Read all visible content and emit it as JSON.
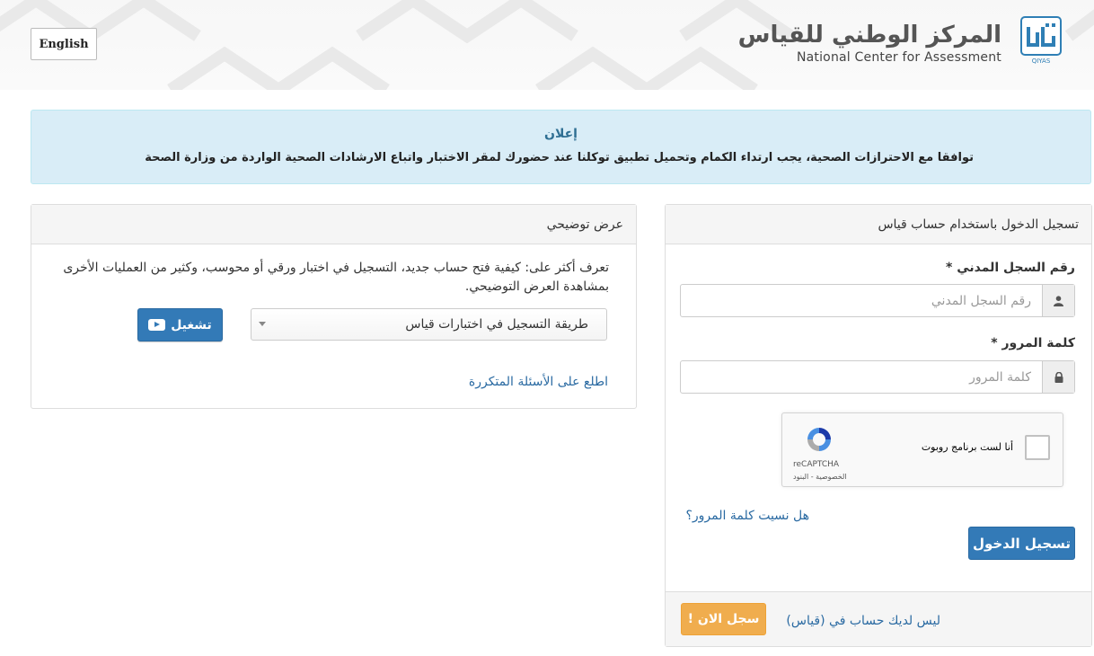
{
  "header": {
    "lang_button": "English",
    "logo_ar": "المركز الوطني للقياس",
    "logo_en": "National Center for Assessment",
    "logo_mark_text": "QIYAS"
  },
  "announcement": {
    "title": "إعلان",
    "message": "توافقا مع الاحترازات الصحية، يجب ارتداء الكمام وتحميل تطبيق توكلنا عند حضورك لمقر الاختبار واتباع الارشادات الصحية الواردة من وزارة الصحة"
  },
  "demo_panel": {
    "title": "عرض توضيحي",
    "description": "تعرف أكثر على: كيفية فتح حساب جديد، التسجيل في اختبار ورقي أو محوسب، وكثير من العمليات الأخرى بمشاهدة العرض التوضيحي.",
    "select_value": "طريقة التسجيل في اختبارات قياس",
    "play_label": "تشغيل",
    "faq_link": "اطلع على الأسئلة المتكررة"
  },
  "login_panel": {
    "title": "تسجيل الدخول باستخدام حساب قياس",
    "id_label": "رقم السجل المدني *",
    "id_placeholder": "رقم السجل المدني",
    "password_label": "كلمة المرور *",
    "password_placeholder": "كلمة المرور",
    "captcha_label": "أنا لست برنامج روبوت",
    "captcha_brand": "reCAPTCHA",
    "captcha_terms": "الخصوصية - البنود",
    "forgot_link": "هل نسيت كلمة المرور؟",
    "submit_label": "تسجيل الدخول",
    "no_account_text": "ليس لديك حساب في (قياس)",
    "register_label": "سجل الان !"
  },
  "colors": {
    "primary": "#337ab7",
    "warning": "#f0ad4e",
    "info_bg": "#d9edf7",
    "link": "#2a6aa2"
  }
}
